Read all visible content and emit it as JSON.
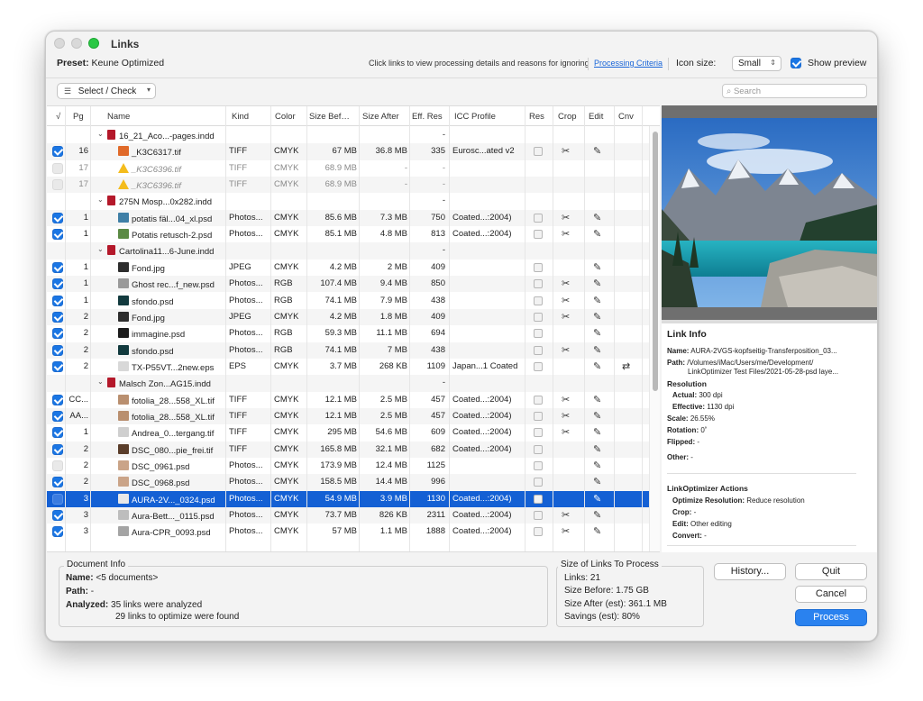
{
  "window": {
    "title": "Links"
  },
  "toolbar": {
    "preset_label": "Preset:",
    "preset_value": "Keune Optimized",
    "hint": "Click links to view processing details and reasons for ignoring",
    "criteria_link": "Processing Criteria",
    "icon_size_label": "Icon size:",
    "icon_size_value": "Small",
    "show_preview_label": "Show preview",
    "show_preview_checked": true
  },
  "filterbar": {
    "select_check_label": "Select / Check",
    "search_placeholder": "Search"
  },
  "table": {
    "columns": {
      "check": "√",
      "pg": "Pg",
      "name": "Name",
      "kind": "Kind",
      "color": "Color",
      "size_before": "Size Bef…",
      "size_after": "Size After",
      "eff_res": "Eff. Res",
      "icc": "ICC Profile",
      "res": "Res",
      "crop": "Crop",
      "edit": "Edit",
      "cnv": "Cnv"
    },
    "rows": [
      {
        "type": "group",
        "name": "16_21_Aco...-pages.indd",
        "eff": "-"
      },
      {
        "type": "link",
        "check": "on",
        "pg": "16",
        "thumb": "#e06a2a",
        "name": "_K3C6317.tif",
        "kind": "TIFF",
        "color": "CMYK",
        "before": "67 MB",
        "after": "36.8 MB",
        "eff": "335",
        "icc": "Eurosc...ated v2",
        "res": true,
        "crop": true,
        "edit": true
      },
      {
        "type": "link",
        "check": "dim",
        "pg": "17",
        "warn": true,
        "name": "_K3C6396.tif",
        "kind": "TIFF",
        "color": "CMYK",
        "before": "68.9 MB",
        "after": "-",
        "eff": "-",
        "muted": true
      },
      {
        "type": "link",
        "check": "dim",
        "pg": "17",
        "warn": true,
        "name": "_K3C6396.tif",
        "kind": "TIFF",
        "color": "CMYK",
        "before": "68.9 MB",
        "after": "-",
        "eff": "-",
        "muted": true
      },
      {
        "type": "group",
        "name": "275N Mosp...0x282.indd",
        "eff": "-"
      },
      {
        "type": "link",
        "check": "on",
        "pg": "1",
        "thumb": "#3f7fa6",
        "name": "potatis fäl...04_xl.psd",
        "kind": "Photos...",
        "color": "CMYK",
        "before": "85.6 MB",
        "after": "7.3 MB",
        "eff": "750",
        "icc": "Coated...:2004)",
        "res": true,
        "crop": true,
        "edit": true
      },
      {
        "type": "link",
        "check": "on",
        "pg": "1",
        "thumb": "#5b8a44",
        "name": "Potatis retusch-2.psd",
        "kind": "Photos...",
        "color": "CMYK",
        "before": "85.1 MB",
        "after": "4.8 MB",
        "eff": "813",
        "icc": "Coated...:2004)",
        "res": true,
        "crop": true,
        "edit": true
      },
      {
        "type": "group",
        "name": "Cartolina11...6-June.indd",
        "eff": "-"
      },
      {
        "type": "link",
        "check": "on",
        "pg": "1",
        "thumb": "#2d2d2d",
        "name": "Fond.jpg",
        "kind": "JPEG",
        "color": "CMYK",
        "before": "4.2 MB",
        "after": "2 MB",
        "eff": "409",
        "icc": "",
        "res": true,
        "crop": false,
        "edit": true
      },
      {
        "type": "link",
        "check": "on",
        "pg": "1",
        "thumb": "#9a9a9a",
        "name": "Ghost rec...f_new.psd",
        "kind": "Photos...",
        "color": "RGB",
        "before": "107.4 MB",
        "after": "9.4 MB",
        "eff": "850",
        "icc": "",
        "res": true,
        "crop": true,
        "edit": true
      },
      {
        "type": "link",
        "check": "on",
        "pg": "1",
        "thumb": "#123a3e",
        "name": "sfondo.psd",
        "kind": "Photos...",
        "color": "RGB",
        "before": "74.1 MB",
        "after": "7.9 MB",
        "eff": "438",
        "icc": "",
        "res": true,
        "crop": true,
        "edit": true
      },
      {
        "type": "link",
        "check": "on",
        "pg": "2",
        "thumb": "#2d2d2d",
        "name": "Fond.jpg",
        "kind": "JPEG",
        "color": "CMYK",
        "before": "4.2 MB",
        "after": "1.8 MB",
        "eff": "409",
        "icc": "",
        "res": true,
        "crop": true,
        "edit": true
      },
      {
        "type": "link",
        "check": "on",
        "pg": "2",
        "thumb": "#1c1c1c",
        "name": "immagine.psd",
        "kind": "Photos...",
        "color": "RGB",
        "before": "59.3 MB",
        "after": "11.1 MB",
        "eff": "694",
        "icc": "",
        "res": true,
        "crop": false,
        "edit": true
      },
      {
        "type": "link",
        "check": "on",
        "pg": "2",
        "thumb": "#123a3e",
        "name": "sfondo.psd",
        "kind": "Photos...",
        "color": "RGB",
        "before": "74.1 MB",
        "after": "7 MB",
        "eff": "438",
        "icc": "",
        "res": true,
        "crop": true,
        "edit": true
      },
      {
        "type": "link",
        "check": "on",
        "pg": "2",
        "thumb": "#d8d8d8",
        "name": "TX-P55VT...2new.eps",
        "kind": "EPS",
        "color": "CMYK",
        "before": "3.7 MB",
        "after": "268 KB",
        "eff": "1109",
        "icc": "Japan...1 Coated",
        "res": true,
        "crop": false,
        "edit": true,
        "cnv": true
      },
      {
        "type": "group",
        "name": "Malsch Zon...AG15.indd",
        "eff": "-"
      },
      {
        "type": "link",
        "check": "on",
        "pg": "CC...",
        "thumb": "#b98f6f",
        "name": "fotolia_28...558_XL.tif",
        "kind": "TIFF",
        "color": "CMYK",
        "before": "12.1 MB",
        "after": "2.5 MB",
        "eff": "457",
        "icc": "Coated...:2004)",
        "res": true,
        "crop": true,
        "edit": true
      },
      {
        "type": "link",
        "check": "on",
        "pg": "AA...",
        "thumb": "#b98f6f",
        "name": "fotolia_28...558_XL.tif",
        "kind": "TIFF",
        "color": "CMYK",
        "before": "12.1 MB",
        "after": "2.5 MB",
        "eff": "457",
        "icc": "Coated...:2004)",
        "res": true,
        "crop": true,
        "edit": true
      },
      {
        "type": "link",
        "check": "on",
        "pg": "1",
        "thumb": "#cfcfcf",
        "name": "Andrea_0...tergang.tif",
        "kind": "TIFF",
        "color": "CMYK",
        "before": "295 MB",
        "after": "54.6 MB",
        "eff": "609",
        "icc": "Coated...:2004)",
        "res": true,
        "crop": true,
        "edit": true
      },
      {
        "type": "link",
        "check": "on",
        "pg": "2",
        "thumb": "#5a3d2a",
        "name": "DSC_080...pie_frei.tif",
        "kind": "TIFF",
        "color": "CMYK",
        "before": "165.8 MB",
        "after": "32.1 MB",
        "eff": "682",
        "icc": "Coated...:2004)",
        "res": true,
        "crop": false,
        "edit": true
      },
      {
        "type": "link",
        "check": "dim",
        "pg": "2",
        "thumb": "#caa488",
        "name": "DSC_0961.psd",
        "kind": "Photos...",
        "color": "CMYK",
        "before": "173.9 MB",
        "after": "12.4 MB",
        "eff": "1125",
        "icc": "",
        "res": true,
        "crop": false,
        "edit": true
      },
      {
        "type": "link",
        "check": "on",
        "pg": "2",
        "thumb": "#caa488",
        "name": "DSC_0968.psd",
        "kind": "Photos...",
        "color": "CMYK",
        "before": "158.5 MB",
        "after": "14.4 MB",
        "eff": "996",
        "icc": "",
        "res": true,
        "crop": false,
        "edit": true
      },
      {
        "type": "link",
        "check": "sel",
        "pg": "3",
        "thumb": "#e8e8e8",
        "name": "AURA-2V..._0324.psd",
        "kind": "Photos...",
        "color": "CMYK",
        "before": "54.9 MB",
        "after": "3.9 MB",
        "eff": "1130",
        "icc": "Coated...:2004)",
        "res": true,
        "crop": false,
        "edit": true,
        "selected": true
      },
      {
        "type": "link",
        "check": "on",
        "pg": "3",
        "thumb": "#bdbdbd",
        "name": "Aura-Bett..._0115.psd",
        "kind": "Photos...",
        "color": "CMYK",
        "before": "73.7 MB",
        "after": "826 KB",
        "eff": "2311",
        "icc": "Coated...:2004)",
        "res": true,
        "crop": true,
        "edit": true
      },
      {
        "type": "link",
        "check": "on",
        "pg": "3",
        "thumb": "#a4a4a4",
        "name": "Aura-CPR_0093.psd",
        "kind": "Photos...",
        "color": "CMYK",
        "before": "57 MB",
        "after": "1.1 MB",
        "eff": "1888",
        "icc": "Coated...:2004)",
        "res": true,
        "crop": true,
        "edit": true
      }
    ]
  },
  "link_info": {
    "title": "Link Info",
    "name_label": "Name:",
    "name_value": "AURA-2VGS-kopfseitig-Transferposition_03...",
    "path_label": "Path:",
    "path_value_1": "/Volumes/iMac/Users/me/Development/",
    "path_value_2": "LinkOptimizer Test Files/2021-05-28-psd laye...",
    "resolution_title": "Resolution",
    "actual_label": "Actual:",
    "actual_value": "300 dpi",
    "effective_label": "Effective:",
    "effective_value": "1130 dpi",
    "scale_label": "Scale:",
    "scale_value": "26.55%",
    "rotation_label": "Rotation:",
    "rotation_value": "0˚",
    "flipped_label": "Flipped:",
    "flipped_value": "-",
    "other_label": "Other:",
    "other_value": "-",
    "actions_title": "LinkOptimizer Actions",
    "optimize_label": "Optimize Resolution:",
    "optimize_value": "Reduce resolution",
    "crop_label": "Crop:",
    "crop_value": "-",
    "edit_label": "Edit:",
    "edit_value": "Other editing",
    "convert_label": "Convert:",
    "convert_value": "-"
  },
  "document_info": {
    "title": "Document Info",
    "name_label": "Name:",
    "name_value": "<5 documents>",
    "path_label": "Path:",
    "path_value": "-",
    "analyzed_label": "Analyzed:",
    "analyzed_line1": "35 links were analyzed",
    "analyzed_line2": "29 links to optimize were found"
  },
  "size_info": {
    "title": "Size of Links To Process",
    "links": "Links: 21",
    "before": "Size Before: 1.75 GB",
    "after": "Size After (est): 361.1 MB",
    "savings": "Savings (est): 80%"
  },
  "buttons": {
    "history": "History...",
    "quit": "Quit",
    "cancel": "Cancel",
    "process": "Process"
  },
  "colors": {
    "accent": "#1a76e4",
    "selection": "#1460d4",
    "link": "#1a66d8",
    "doc_icon": "#b4182a",
    "warning": "#f4bc1c"
  }
}
